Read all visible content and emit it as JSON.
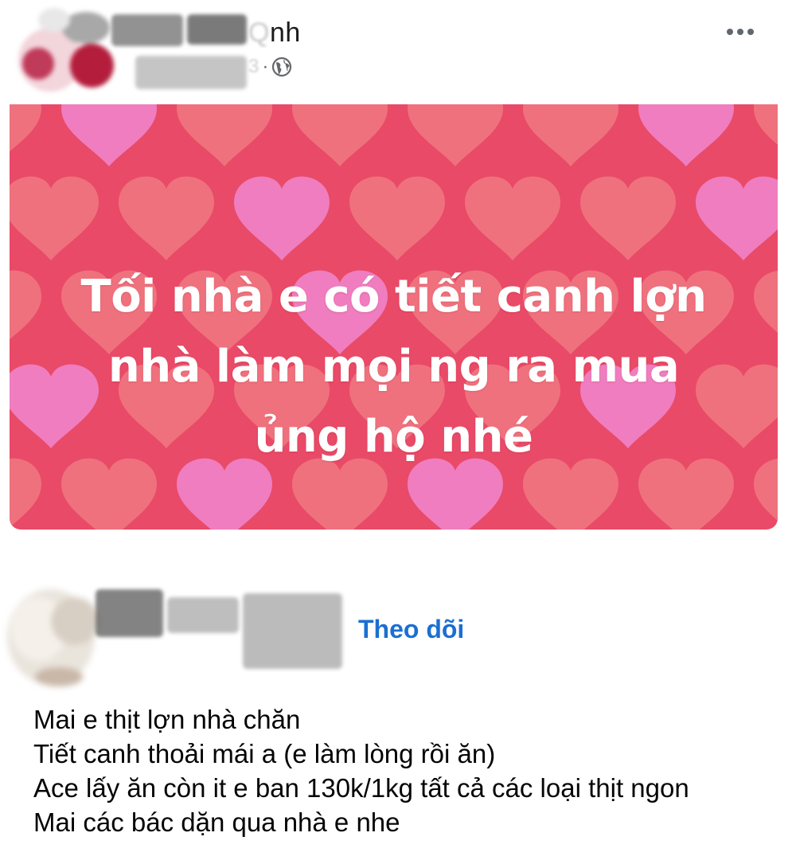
{
  "post1": {
    "author_name_visible": "nh",
    "author_name_faint": "Q",
    "meta_faint": "3",
    "meta_separator": "·",
    "privacy_icon": "globe-icon",
    "more_icon": "more-options-icon",
    "banner": {
      "lines": [
        "Tối nhà e có tiết canh lợn",
        "nhà làm mọi ng ra mua",
        "ủng hộ nhé"
      ],
      "background_color": "#e94a67",
      "heart_color": "#f07a83",
      "accent_heart_color": "#ef7fc4"
    }
  },
  "post2": {
    "follow_label": "Theo dõi",
    "follow_color": "#1b6fd1",
    "body_lines": [
      "Mai e thịt lợn nhà chăn",
      "Tiết canh thoải mái a (e làm lòng rồi ăn)",
      "Ace lấy ăn còn it e ban 130k/1kg tất cả các loại thịt ngon",
      "Mai các bác dặn qua nhà e nhe"
    ]
  }
}
